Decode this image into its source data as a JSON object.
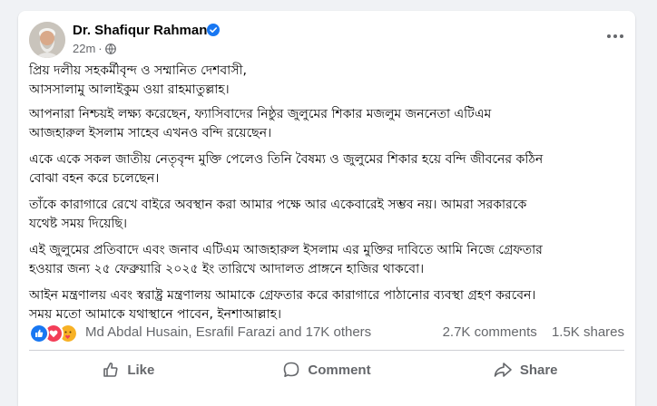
{
  "post": {
    "author": "Dr. Shafiqur Rahman",
    "timestamp": "22m",
    "separator": "·",
    "privacy_icon": "globe-icon",
    "verified_icon": "verified-badge-icon",
    "more_icon": "more-options-icon",
    "paragraphs": [
      {
        "lines": [
          "প্রিয় দলীয় সহকর্মীবৃন্দ ও সম্মানিত দেশবাসী,",
          "আসসালামু আলাইকুম ওয়া রাহমাতুল্লাহ।"
        ]
      },
      {
        "lines": [
          "আপনারা নিশ্চয়ই লক্ষ্য করেছেন, ফ্যাসিবাদের নিষ্ঠুর জুলুমের শিকার মজলুম জননেতা এটিএম",
          "আজহারুল ইসলাম সাহেব এখনও বন্দি রয়েছেন।"
        ]
      },
      {
        "lines": [
          "একে একে সকল জাতীয় নেতৃবৃন্দ মুক্তি পেলেও তিনি বৈষম্য ও জুলুমের শিকার হয়ে বন্দি জীবনের কঠিন",
          "বোঝা বহন করে চলেছেন।"
        ]
      },
      {
        "lines": [
          "তাঁকে কারাগারে রেখে বাইরে অবস্থান করা আমার পক্ষে আর একেবারেই সম্ভব নয়। আমরা সরকারকে",
          "যথেষ্ট সময় দিয়েছি।"
        ]
      },
      {
        "lines": [
          "এই জুলুমের প্রতিবাদে এবং জনাব এটিএম আজহারুল ইসলাম এর মুক্তির দাবিতে আমি নিজে গ্রেফতার",
          "হওয়ার জন্য ২৫ ফেব্রুয়ারি ২০২৫ ইং তারিখে আদালত প্রাঙ্গনে হাজির থাকবো।"
        ]
      },
      {
        "lines": [
          "আইন মন্ত্রণালয় এবং স্বরাষ্ট্র মন্ত্রণালয় আমাকে গ্রেফতার করে কারাগারে পাঠানোর ব্যবস্থা গ্রহণ করবেন।",
          "সময় মতো আমাকে যথাস্থানে পাবেন, ইনশাআল্লাহ।"
        ]
      }
    ]
  },
  "reactions": {
    "icons": [
      "like-reaction-icon",
      "love-reaction-icon",
      "care-reaction-icon"
    ],
    "summary": "Md Abdal Husain, Esrafil Farazi and 17K others",
    "comments": "2.7K comments",
    "shares": "1.5K shares"
  },
  "actions": {
    "like": "Like",
    "comment": "Comment",
    "share": "Share"
  },
  "colors": {
    "verified": "#1877f2",
    "like": "#1877f2",
    "love": "#f33e58",
    "care": "#f7b125",
    "muted": "#65676b"
  }
}
